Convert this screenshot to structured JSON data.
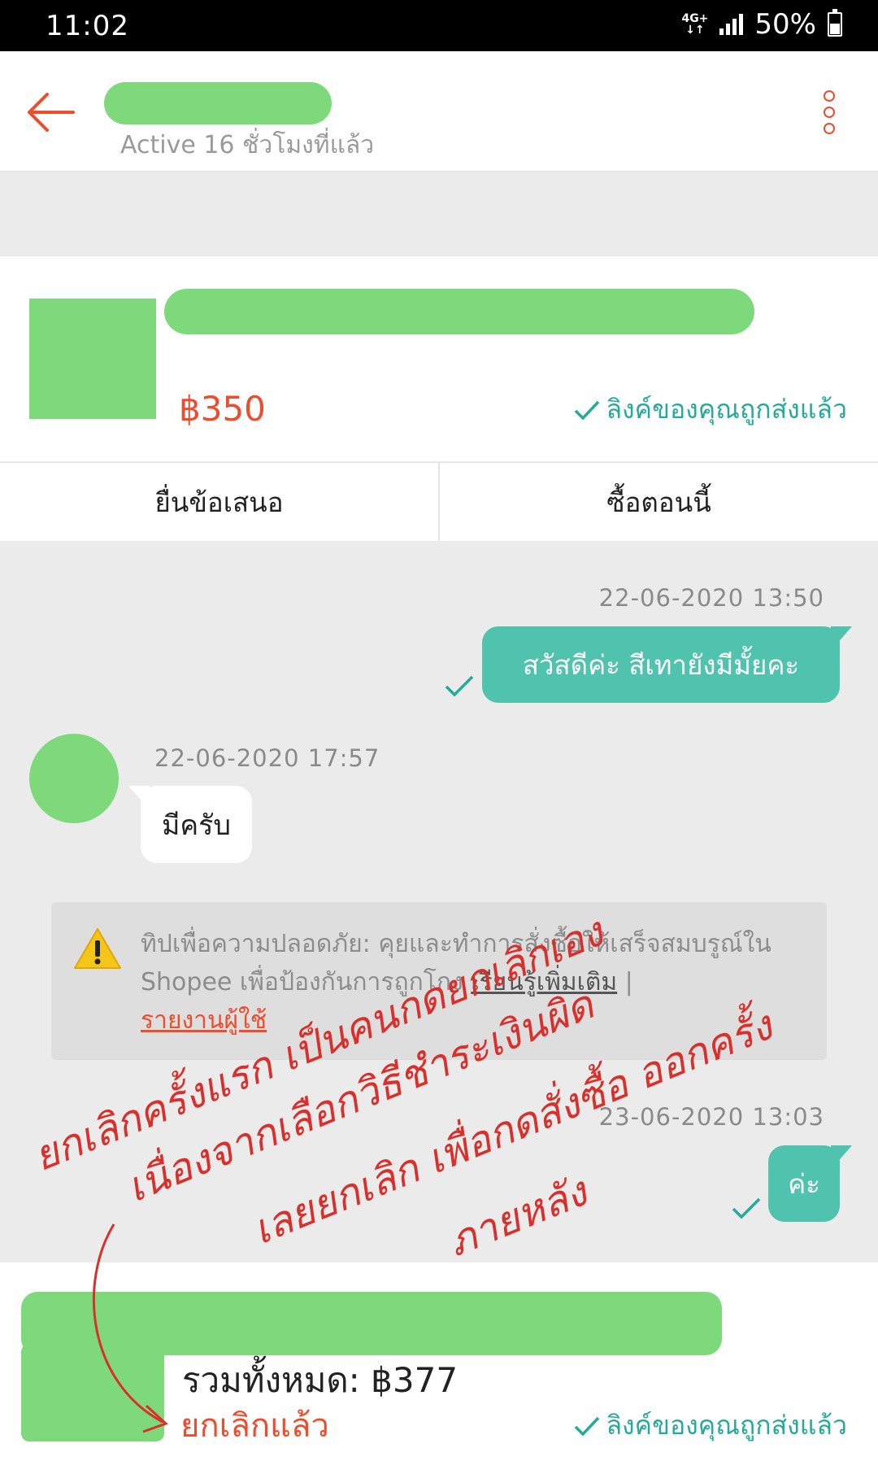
{
  "status_bar": {
    "time": "11:02",
    "network": "4G+",
    "battery": "50%"
  },
  "header": {
    "active_status": "Active 16 ชั่วโมงที่แล้ว"
  },
  "product": {
    "price": "฿350",
    "link_status": "ลิงค์ของคุณถูกส่งแล้ว"
  },
  "actions": {
    "offer_label": "ยื่นข้อเสนอ",
    "buy_label": "ซื้อตอนนี้"
  },
  "messages": [
    {
      "timestamp": "22-06-2020 13:50",
      "text": "สวัสดีค่ะ สีเทายังมีมั้ยคะ",
      "direction": "out"
    },
    {
      "timestamp": "22-06-2020 17:57",
      "text": "มีครับ",
      "direction": "in"
    },
    {
      "timestamp": "23-06-2020 13:03",
      "text": "ค่ะ",
      "direction": "out"
    }
  ],
  "safety_tip": {
    "text": "ทิปเพื่อความปลอดภัย: คุยและทำการสั่งซื้อให้เสร็จสมบรูณ์ใน Shopee เพื่อป้องกันการถูกโกง ",
    "learn_more": "เรียนรู้เพิ่มเติม",
    "separator": " | ",
    "report_user": "รายงานผู้ใช้"
  },
  "order": {
    "total": "รวมทั้งหมด: ฿377",
    "status": "ยกเลิกแล้ว",
    "link_status": "ลิงค์ของคุณถูกส่งแล้ว"
  },
  "annotation": {
    "lines": [
      "ยกเลิกครั้งแรก เป็นคนกดยกเลิกเอง",
      "เนื่องจากเลือกวิธีชำระเงินผิด",
      "เลยยกเลิก เพื่อกดสั่งซื้อ ออกครั้ง",
      "ภายหลัง"
    ],
    "color": "#d9302c"
  },
  "colors": {
    "brand": "#ee4d2d",
    "teal": "#26aa99",
    "bubble_out": "#4fc3ad",
    "redaction": "#7dd97a"
  }
}
